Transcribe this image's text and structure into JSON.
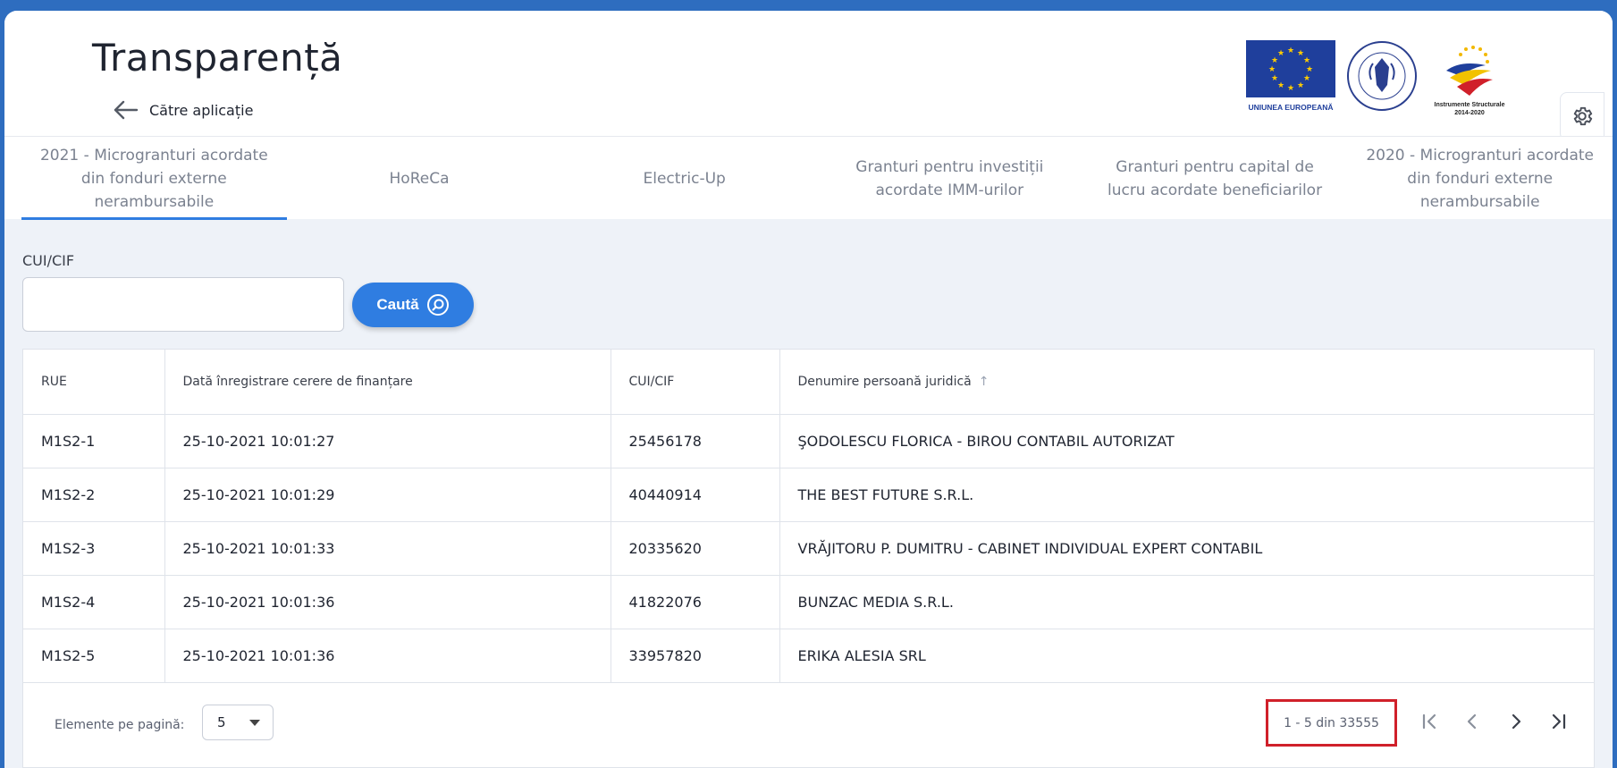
{
  "header": {
    "title": "Transparență",
    "back_label": "Către aplicație",
    "eu_logo_text": "UNIUNEA EUROPEANĂ",
    "gov_logo_text": "GUVERNUL ROMÂNIEI",
    "is_logo_text": "Instrumente Structurale 2014-2020"
  },
  "tabs": [
    {
      "label": "2021 - Microgranturi acordate din fonduri externe nerambursabile",
      "active": true
    },
    {
      "label": "HoReCa",
      "active": false
    },
    {
      "label": "Electric-Up",
      "active": false
    },
    {
      "label": "Granturi pentru investiții acordate IMM-urilor",
      "active": false
    },
    {
      "label": "Granturi pentru capital de lucru acordate beneficiarilor",
      "active": false
    },
    {
      "label": "2020 - Microgranturi acordate din fonduri externe nerambursabile",
      "active": false
    }
  ],
  "search": {
    "label": "CUI/CIF",
    "value": "",
    "button_label": "Caută"
  },
  "table": {
    "columns": [
      "RUE",
      "Dată înregistrare cerere de finanțare",
      "CUI/CIF",
      "Denumire persoană juridică"
    ],
    "sort_column": "Denumire persoană juridică",
    "rows": [
      [
        "M1S2-1",
        "25-10-2021 10:01:27",
        "25456178",
        "ŞODOLESCU FLORICA - BIROU CONTABIL AUTORIZAT"
      ],
      [
        "M1S2-2",
        "25-10-2021 10:01:29",
        "40440914",
        "THE BEST FUTURE S.R.L."
      ],
      [
        "M1S2-3",
        "25-10-2021 10:01:33",
        "20335620",
        "VRĂJITORU P. DUMITRU - CABINET INDIVIDUAL EXPERT CONTABIL"
      ],
      [
        "M1S2-4",
        "25-10-2021 10:01:36",
        "41822076",
        "BUNZAC MEDIA S.R.L."
      ],
      [
        "M1S2-5",
        "25-10-2021 10:01:36",
        "33957820",
        "ERIKA ALESIA SRL"
      ]
    ]
  },
  "pagination": {
    "per_page_label": "Elemente pe pagină:",
    "per_page_value": "5",
    "range_text": "1 - 5 din 33555"
  },
  "colors": {
    "accent": "#2f7de1",
    "top_bar": "#2e6dbf",
    "highlight_box": "#d0202a"
  }
}
